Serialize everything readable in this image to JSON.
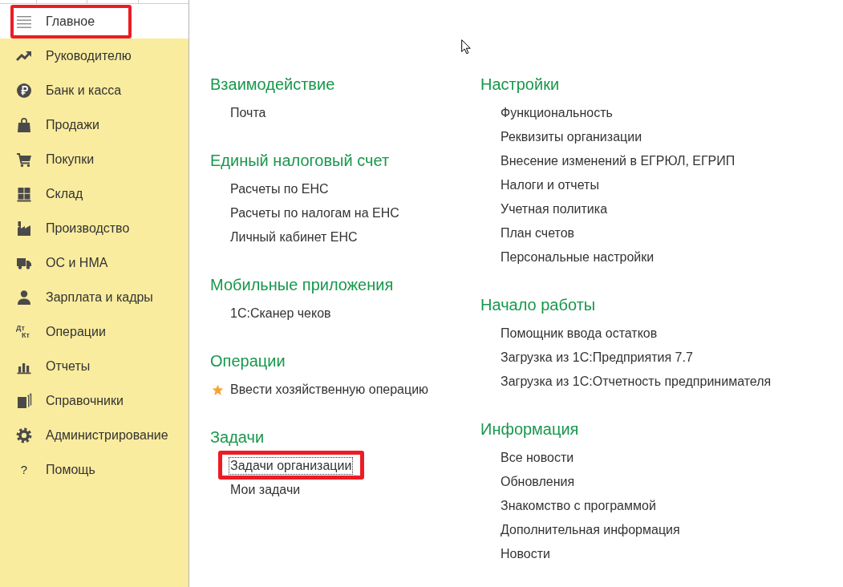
{
  "sidebar": {
    "items": [
      {
        "label": "Главное",
        "selected": true,
        "highlighted": true
      },
      {
        "label": "Руководителю",
        "selected": false,
        "highlighted": false
      },
      {
        "label": "Банк и касса",
        "selected": false,
        "highlighted": false
      },
      {
        "label": "Продажи",
        "selected": false,
        "highlighted": false
      },
      {
        "label": "Покупки",
        "selected": false,
        "highlighted": false
      },
      {
        "label": "Склад",
        "selected": false,
        "highlighted": false
      },
      {
        "label": "Производство",
        "selected": false,
        "highlighted": false
      },
      {
        "label": "ОС и НМА",
        "selected": false,
        "highlighted": false
      },
      {
        "label": "Зарплата и кадры",
        "selected": false,
        "highlighted": false
      },
      {
        "label": "Операции",
        "icon_text": [
          "Дт",
          "Кт"
        ],
        "selected": false,
        "highlighted": false
      },
      {
        "label": "Отчеты",
        "selected": false,
        "highlighted": false
      },
      {
        "label": "Справочники",
        "selected": false,
        "highlighted": false
      },
      {
        "label": "Администрирование",
        "selected": false,
        "highlighted": false
      },
      {
        "label": "Помощь",
        "icon_text": [
          "?"
        ],
        "selected": false,
        "highlighted": false
      }
    ]
  },
  "main": {
    "columns": [
      {
        "sections": [
          {
            "title": "Взаимодействие",
            "items": [
              {
                "label": "Почта"
              }
            ]
          },
          {
            "title": "Единый налоговый счет",
            "items": [
              {
                "label": "Расчеты по ЕНС"
              },
              {
                "label": "Расчеты по налогам на ЕНС"
              },
              {
                "label": "Личный кабинет ЕНС"
              }
            ]
          },
          {
            "title": "Мобильные приложения",
            "items": [
              {
                "label": "1С:Сканер чеков"
              }
            ]
          },
          {
            "title": "Операции",
            "items": [
              {
                "label": "Ввести хозяйственную операцию",
                "starred": true
              }
            ]
          },
          {
            "title": "Задачи",
            "items": [
              {
                "label": "Задачи организации",
                "focused": true,
                "highlighted": true
              },
              {
                "label": "Мои задачи",
                "focused": false,
                "highlighted": false
              }
            ]
          }
        ]
      },
      {
        "sections": [
          {
            "title": "Настройки",
            "items": [
              {
                "label": "Функциональность"
              },
              {
                "label": "Реквизиты организации"
              },
              {
                "label": "Внесение изменений в ЕГРЮЛ, ЕГРИП"
              },
              {
                "label": "Налоги и отчеты"
              },
              {
                "label": "Учетная политика"
              },
              {
                "label": "План счетов"
              },
              {
                "label": "Персональные настройки"
              }
            ]
          },
          {
            "title": "Начало работы",
            "items": [
              {
                "label": "Помощник ввода остатков"
              },
              {
                "label": "Загрузка из 1С:Предприятия 7.7"
              },
              {
                "label": "Загрузка из 1С:Отчетность предпринимателя"
              }
            ]
          },
          {
            "title": "Информация",
            "items": [
              {
                "label": "Все новости"
              },
              {
                "label": "Обновления"
              },
              {
                "label": "Знакомство с программой"
              },
              {
                "label": "Дополнительная информация"
              },
              {
                "label": "Новости"
              }
            ]
          }
        ]
      }
    ]
  }
}
